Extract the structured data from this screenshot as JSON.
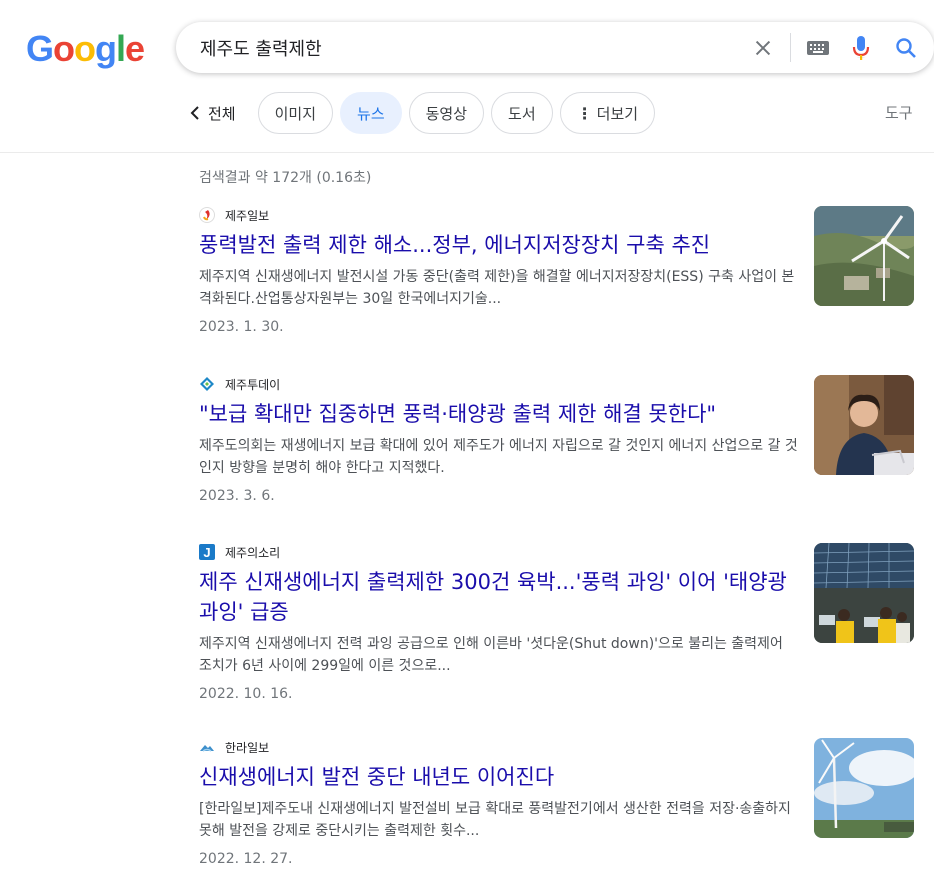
{
  "logo": {
    "letters": [
      "G",
      "o",
      "o",
      "g",
      "l",
      "e"
    ],
    "colors": [
      "#4285F4",
      "#EA4335",
      "#FBBC05",
      "#4285F4",
      "#34A853",
      "#EA4335"
    ]
  },
  "search": {
    "query": "제주도 출력제한",
    "icons": [
      "close-icon",
      "keyboard-icon",
      "mic-icon",
      "search-icon"
    ]
  },
  "tabs": {
    "back_label": "전체",
    "items": [
      {
        "label": "이미지",
        "active": false
      },
      {
        "label": "뉴스",
        "active": true
      },
      {
        "label": "동영상",
        "active": false
      },
      {
        "label": "도서",
        "active": false
      },
      {
        "label": "더보기",
        "active": false
      }
    ],
    "tools_label": "도구"
  },
  "stats": "검색결과 약 172개 (0.16초)",
  "results": [
    {
      "source": "제주일보",
      "title": "풍력발전 출력 제한 해소...정부, 에너지저장장치 구축 추진",
      "snippet": "제주지역 신재생에너지 발전시설 가동 중단(출력 제한)을 해결할 에너지저장장치(ESS) 구축 사업이 본격화된다.산업통상자원부는 30일 한국에너지기술...",
      "date": "2023. 1. 30."
    },
    {
      "source": "제주투데이",
      "title": "\"보급 확대만 집중하면 풍력·태양광 출력 제한 해결 못한다\"",
      "snippet": "제주도의회는 재생에너지 보급 확대에 있어 제주도가 에너지 자립으로 갈 것인지 에너지 산업으로 갈 것인지 방향을 분명히 해야 한다고 지적했다.",
      "date": "2023. 3. 6."
    },
    {
      "source": "제주의소리",
      "title": "제주 신재생에너지 출력제한 300건 육박...'풍력 과잉' 이어 '태양광 과잉' 급증",
      "snippet": "제주지역 신재생에너지 전력 과잉 공급으로 인해 이른바 '셧다운(Shut down)'으로 불리는 출력제어 조치가 6년 사이에 299일에 이른 것으로...",
      "date": "2022. 10. 16."
    },
    {
      "source": "한라일보",
      "title": "신재생에너지 발전 중단 내년도 이어진다",
      "snippet": "[한라일보]제주도내 신재생에너지 발전설비 보급 확대로 풍력발전기에서 생산한 전력을 저장·송출하지 못해 발전을 강제로 중단시키는 출력제한 횟수...",
      "date": "2022. 12. 27."
    }
  ]
}
